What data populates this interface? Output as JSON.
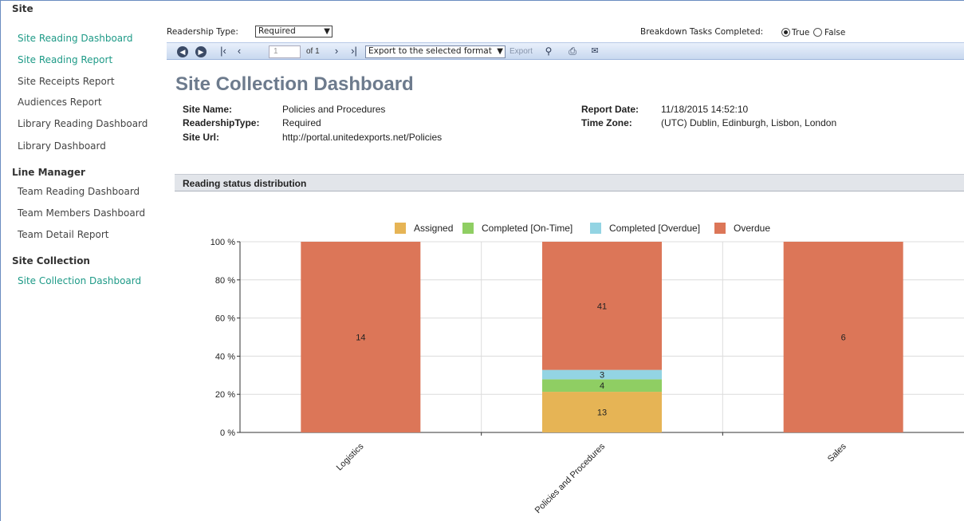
{
  "sidebar": {
    "sections": [
      {
        "title": "Site",
        "items": [
          {
            "label": "Site Reading Dashboard",
            "active": true
          },
          {
            "label": "Site Reading Report",
            "active": true
          },
          {
            "label": "Site Receipts Report",
            "active": false
          },
          {
            "label": "Audiences Report",
            "active": false
          },
          {
            "label": "Library Reading Dashboard",
            "active": false
          },
          {
            "label": "Library Dashboard",
            "active": false
          }
        ]
      },
      {
        "title": "Line Manager",
        "items": [
          {
            "label": "Team Reading Dashboard",
            "active": false
          },
          {
            "label": "Team Members Dashboard",
            "active": false
          },
          {
            "label": "Team Detail Report",
            "active": false
          }
        ]
      },
      {
        "title": "Site Collection",
        "items": [
          {
            "label": "Site Collection Dashboard",
            "active": true
          }
        ]
      }
    ]
  },
  "params": {
    "readership_label": "Readership Type:",
    "readership_value": "Required",
    "breakdown_label": "Breakdown Tasks Completed:",
    "true_label": "True",
    "false_label": "False",
    "selected": "True"
  },
  "toolbar": {
    "page_value": "1",
    "of_label": "of 1",
    "export_select": "Export to the selected format",
    "export_label": "Export"
  },
  "report": {
    "title": "Site Collection Dashboard",
    "site_name_label": "Site Name:",
    "site_name": "Policies and Procedures",
    "readership_label": "ReadershipType:",
    "readership": "Required",
    "site_url_label": "Site Url:",
    "site_url": "http://portal.unitedexports.net/Policies",
    "report_date_label": "Report Date:",
    "report_date": "11/18/2015 14:52:10",
    "time_zone_label": "Time Zone:",
    "time_zone": "(UTC) Dublin, Edinburgh, Lisbon, London",
    "section_title": "Reading status distribution"
  },
  "colors": {
    "accent": "#1e9a87",
    "assigned": "#e6b455",
    "completed_on_time": "#8fce63",
    "completed_overdue": "#93d4e3",
    "overdue": "#dc7658"
  },
  "chart_data": {
    "type": "bar",
    "stacked": true,
    "percent": true,
    "categories": [
      "Logistics",
      "Policies and Procedures",
      "Sales"
    ],
    "series": [
      {
        "name": "Assigned",
        "values": [
          0,
          13,
          0
        ]
      },
      {
        "name": "Completed [On-Time]",
        "values": [
          0,
          4,
          0
        ]
      },
      {
        "name": "Completed [Overdue]",
        "values": [
          0,
          3,
          0
        ]
      },
      {
        "name": "Overdue",
        "values": [
          14,
          41,
          6
        ]
      }
    ],
    "yticks": [
      "0 %",
      "20 %",
      "40 %",
      "60 %",
      "80 %",
      "100 %"
    ],
    "ylim": [
      0,
      100
    ],
    "legend": "top-center",
    "grid": true
  }
}
